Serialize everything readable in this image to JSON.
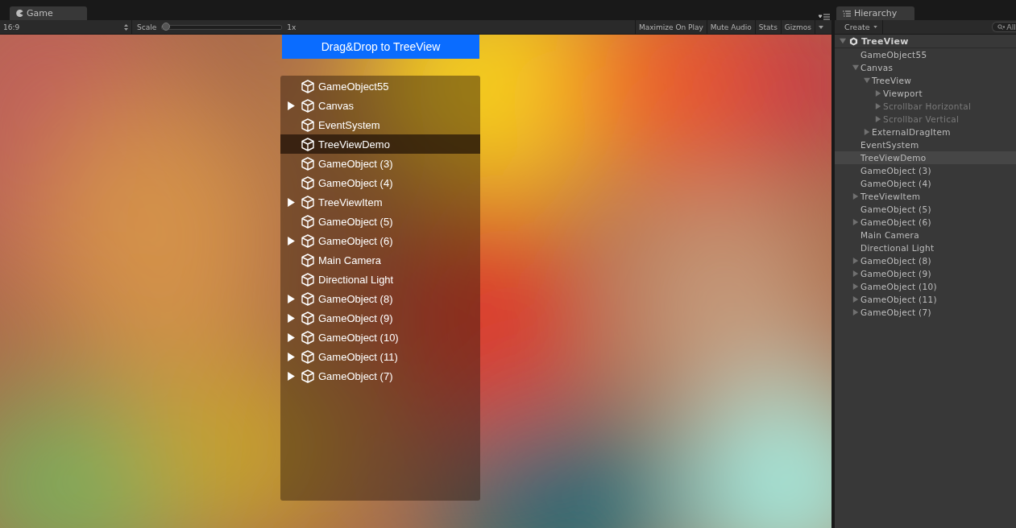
{
  "game_tab": {
    "label": "Game"
  },
  "game_toolbar": {
    "aspect": "16:9",
    "scale_label": "Scale",
    "scale": {
      "level": 0.0
    },
    "scale_value": "1x",
    "buttons": [
      {
        "label": "Maximize On Play",
        "on": false
      },
      {
        "label": "Mute Audio",
        "on": false
      },
      {
        "label": "Stats",
        "on": false
      },
      {
        "label": "Gizmos",
        "on": false
      }
    ]
  },
  "game_view": {
    "drop_button": "Drag&Drop to TreeView",
    "tree_items": [
      {
        "label": "GameObject55",
        "expandable": false,
        "selected": false
      },
      {
        "label": "Canvas",
        "expandable": true,
        "selected": false
      },
      {
        "label": "EventSystem",
        "expandable": false,
        "selected": false
      },
      {
        "label": "TreeViewDemo",
        "expandable": false,
        "selected": true
      },
      {
        "label": "GameObject (3)",
        "expandable": false,
        "selected": false
      },
      {
        "label": "GameObject (4)",
        "expandable": false,
        "selected": false
      },
      {
        "label": "TreeViewItem",
        "expandable": true,
        "selected": false
      },
      {
        "label": "GameObject (5)",
        "expandable": false,
        "selected": false
      },
      {
        "label": "GameObject (6)",
        "expandable": true,
        "selected": false
      },
      {
        "label": "Main Camera",
        "expandable": false,
        "selected": false
      },
      {
        "label": "Directional Light",
        "expandable": false,
        "selected": false
      },
      {
        "label": "GameObject (8)",
        "expandable": true,
        "selected": false
      },
      {
        "label": "GameObject (9)",
        "expandable": true,
        "selected": false
      },
      {
        "label": "GameObject (10)",
        "expandable": true,
        "selected": false
      },
      {
        "label": "GameObject (11)",
        "expandable": true,
        "selected": false
      },
      {
        "label": "GameObject (7)",
        "expandable": true,
        "selected": false
      }
    ]
  },
  "hierarchy": {
    "tab": "Hierarchy",
    "create": "Create",
    "search": "All",
    "scene": {
      "label": "TreeView",
      "expanded": true
    },
    "items": [
      {
        "label": "GameObject55",
        "selected": false,
        "disabled": false
      },
      {
        "label": "Canvas",
        "expanded": true,
        "selected": false,
        "disabled": false,
        "children": [
          {
            "label": "TreeView",
            "expanded": true,
            "selected": false,
            "disabled": false,
            "children": [
              {
                "label": "Viewport",
                "expanded": false,
                "selected": false,
                "disabled": false
              },
              {
                "label": "Scrollbar Horizontal",
                "expanded": false,
                "selected": false,
                "disabled": true
              },
              {
                "label": "Scrollbar Vertical",
                "expanded": false,
                "selected": false,
                "disabled": true
              }
            ]
          },
          {
            "label": "ExternalDragItem",
            "expanded": false,
            "selected": false,
            "disabled": false
          }
        ]
      },
      {
        "label": "EventSystem",
        "selected": false,
        "disabled": false
      },
      {
        "label": "TreeViewDemo",
        "selected": true,
        "disabled": false
      },
      {
        "label": "GameObject (3)",
        "selected": false,
        "disabled": false
      },
      {
        "label": "GameObject (4)",
        "selected": false,
        "disabled": false
      },
      {
        "label": "TreeViewItem",
        "expanded": false,
        "selected": false,
        "disabled": false
      },
      {
        "label": "GameObject (5)",
        "selected": false,
        "disabled": false
      },
      {
        "label": "GameObject (6)",
        "expanded": false,
        "selected": false,
        "disabled": false
      },
      {
        "label": "Main Camera",
        "selected": false,
        "disabled": false
      },
      {
        "label": "Directional Light",
        "selected": false,
        "disabled": false
      },
      {
        "label": "GameObject (8)",
        "expanded": false,
        "selected": false,
        "disabled": false
      },
      {
        "label": "GameObject (9)",
        "expanded": false,
        "selected": false,
        "disabled": false
      },
      {
        "label": "GameObject (10)",
        "expanded": false,
        "selected": false,
        "disabled": false
      },
      {
        "label": "GameObject (11)",
        "expanded": false,
        "selected": false,
        "disabled": false
      },
      {
        "label": "GameObject (7)",
        "expanded": false,
        "selected": false,
        "disabled": false
      }
    ]
  }
}
